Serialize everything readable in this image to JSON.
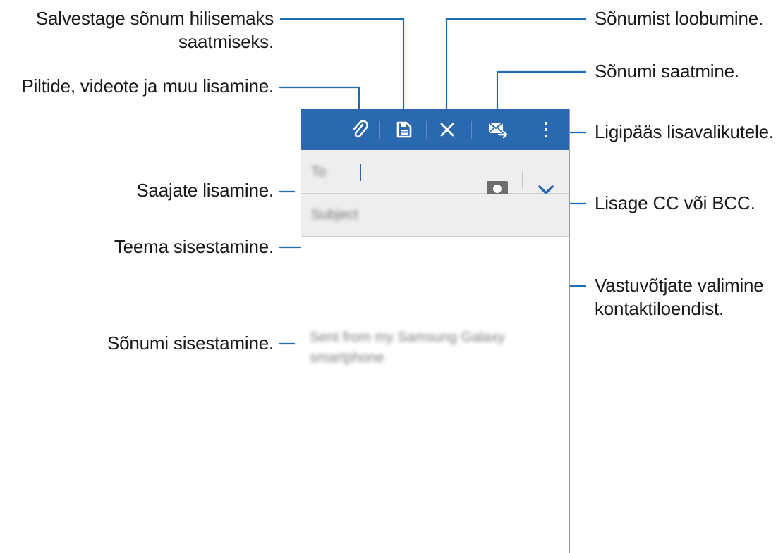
{
  "callouts": {
    "save_draft": [
      "Salvestage sõnum hilisemaks",
      "saatmiseks."
    ],
    "attach": "Piltide, videote ja muu lisamine.",
    "add_recipients": "Saajate lisamine.",
    "enter_subject": "Teema sisestamine.",
    "enter_message": "Sõnumi sisestamine.",
    "discard": "Sõnumist loobumine.",
    "send": "Sõnumi saatmine.",
    "more_options": "Ligipääs lisavalikutele.",
    "cc_bcc": "Lisage CC või BCC.",
    "select_contacts": [
      "Vastuvõtjate valimine",
      "kontaktiloendist."
    ]
  },
  "compose": {
    "to_placeholder": "To",
    "subject_placeholder": "Subject",
    "signature": "Sent from my Samsung Galaxy smartphone"
  },
  "icons": {
    "attach": "paperclip-icon",
    "save": "save-draft-icon",
    "discard": "close-icon",
    "send": "send-mail-icon",
    "more": "more-vertical-icon",
    "contacts": "contact-icon",
    "expand": "chevron-down-icon"
  },
  "colors": {
    "action_bar": "#2a69b0",
    "callout_line": "#1e6db5",
    "field_background": "#eeeeee"
  }
}
